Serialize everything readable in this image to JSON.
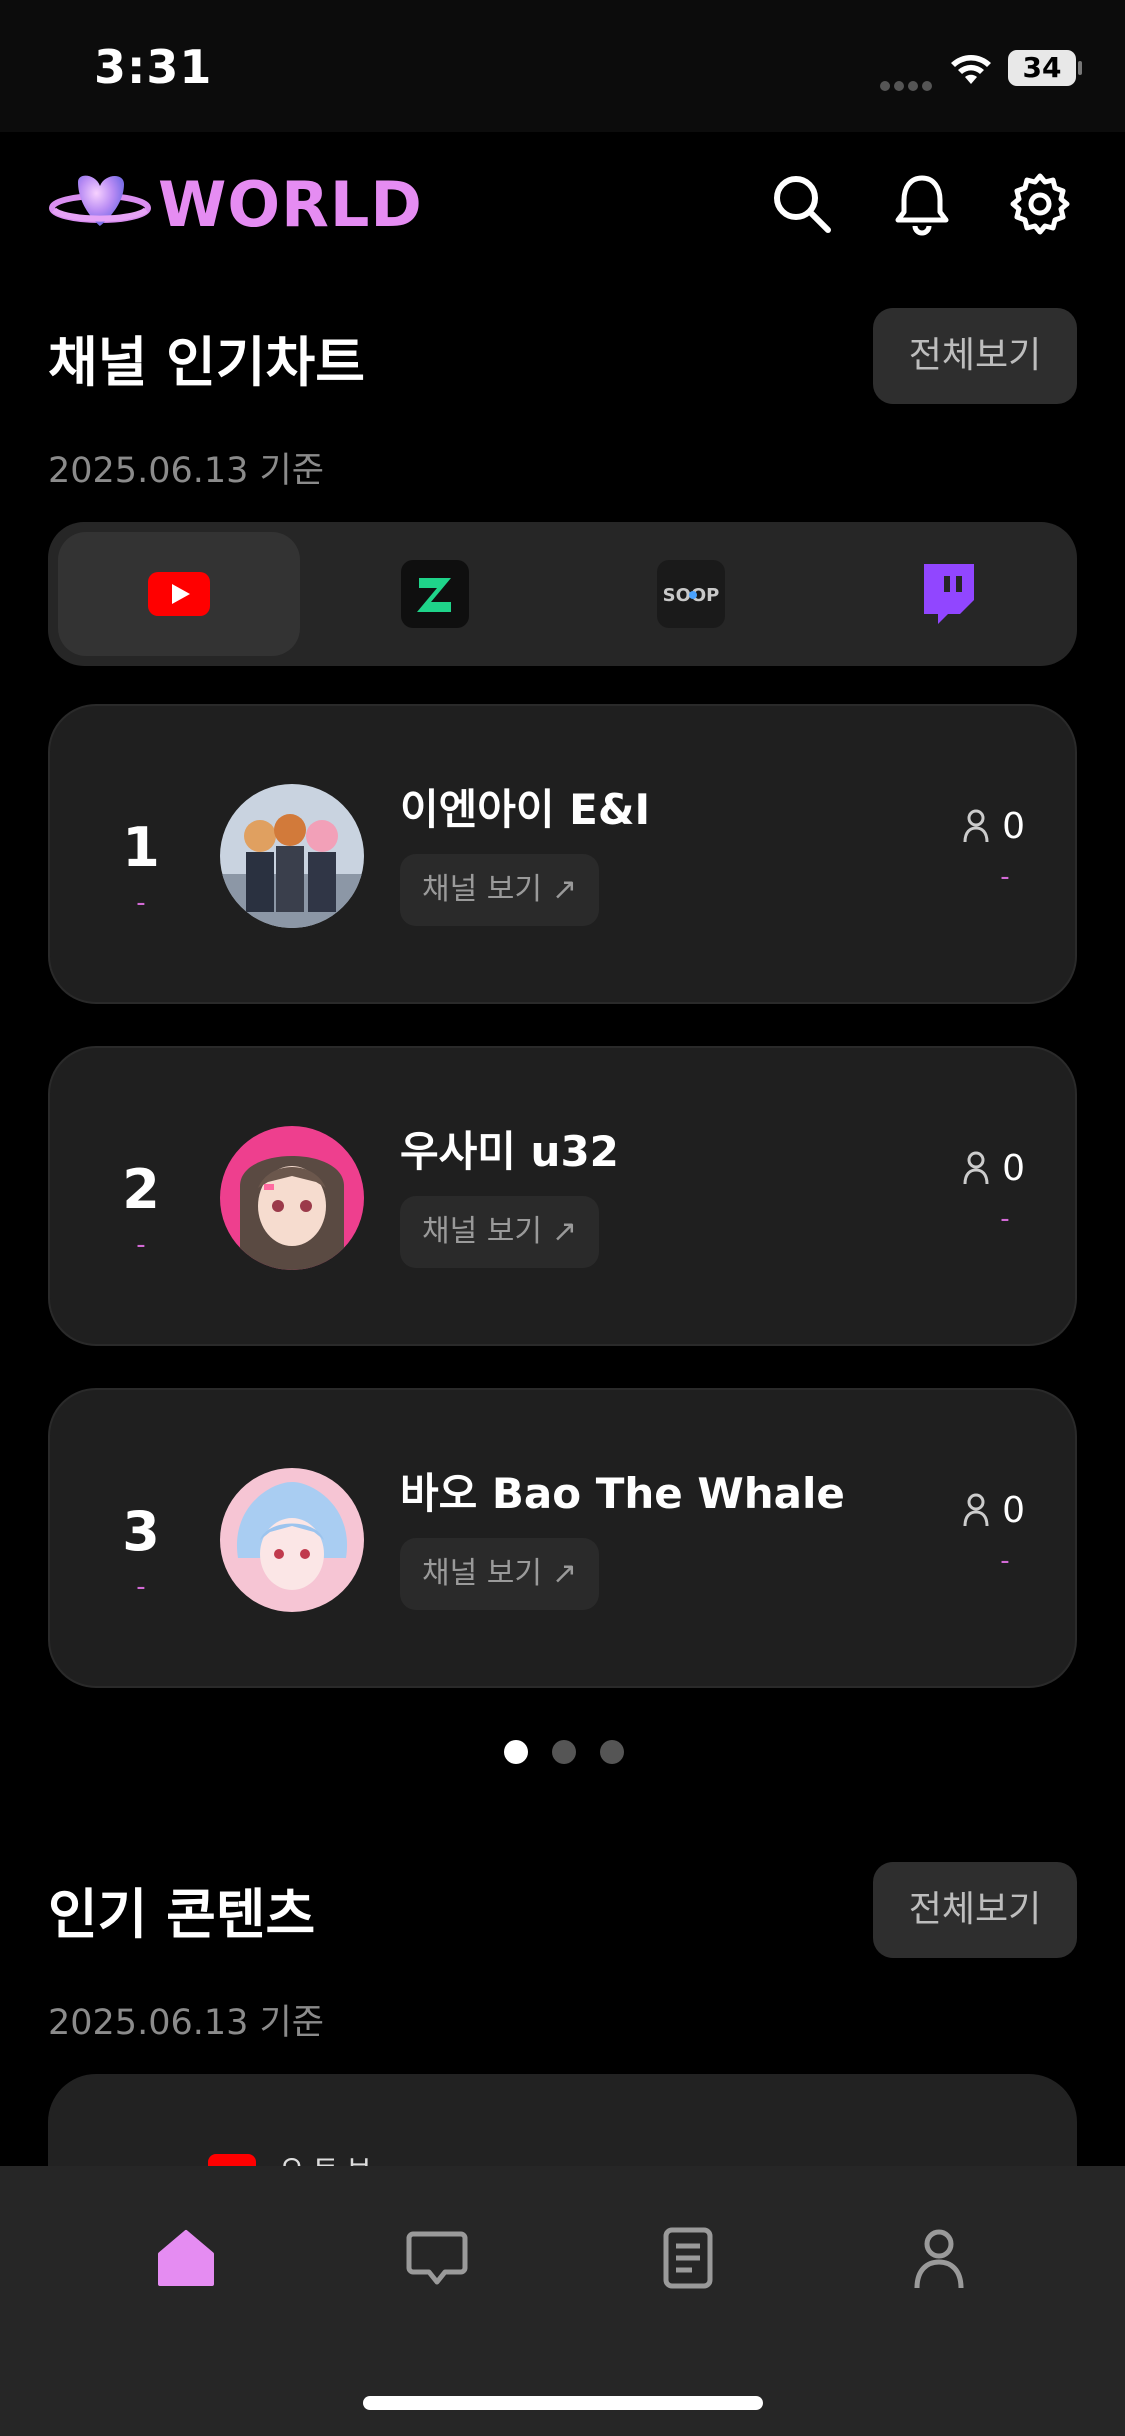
{
  "status_bar": {
    "time": "3:31",
    "battery": "34"
  },
  "header": {
    "logo_text": "WORLD",
    "icons": [
      "search-icon",
      "bell-icon",
      "gear-icon"
    ]
  },
  "channel_chart": {
    "title": "채널 인기차트",
    "date": "2025.06.13 기준",
    "view_all_label": "전체보기",
    "platforms": [
      {
        "name": "youtube-logo",
        "active": true
      },
      {
        "name": "chzzk-logo",
        "active": false
      },
      {
        "name": "soop-logo",
        "label": "SOOP",
        "active": false
      },
      {
        "name": "twitch-logo",
        "active": false
      }
    ],
    "channels": [
      {
        "rank": "1",
        "rank_change": "-",
        "name": "이엔아이 E&I",
        "button": "채널 보기",
        "viewers": "0",
        "viewers_change": "-"
      },
      {
        "rank": "2",
        "rank_change": "-",
        "name": "우사미 u32",
        "button": "채널 보기",
        "viewers": "0",
        "viewers_change": "-"
      },
      {
        "rank": "3",
        "rank_change": "-",
        "name": "바오 Bao The Whale",
        "button": "채널 보기",
        "viewers": "0",
        "viewers_change": "-"
      }
    ],
    "pagination": {
      "pages": 3,
      "active": 1
    }
  },
  "popular_content": {
    "title": "인기 콘텐츠",
    "date": "2025.06.13 기준",
    "view_all_label": "전체보기",
    "peek_text": "ㅇㅌㅂ"
  },
  "tab_bar": {
    "tabs": [
      "home-icon",
      "chat-icon",
      "document-icon",
      "profile-icon"
    ],
    "active": "home-icon"
  },
  "colors": {
    "accent": "#e58cf2",
    "background": "#000000",
    "card": "#1f1f1f"
  }
}
